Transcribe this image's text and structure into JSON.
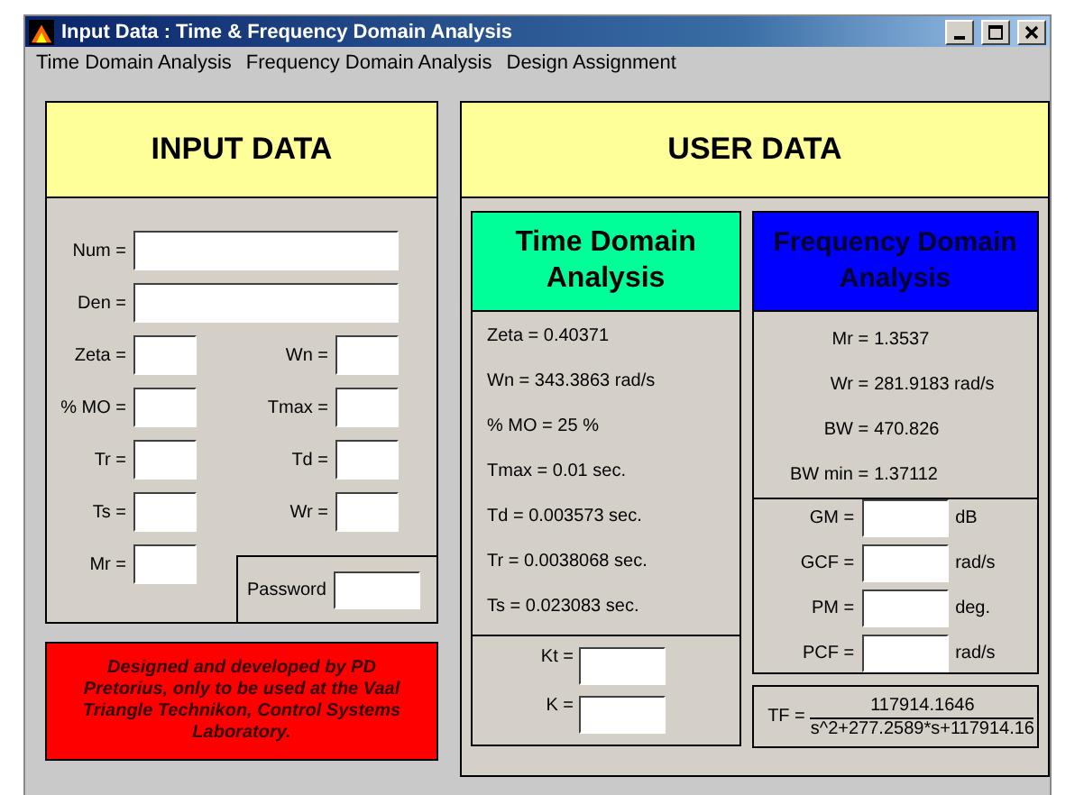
{
  "window": {
    "title": "Input Data : Time & Frequency Domain Analysis"
  },
  "menu": [
    {
      "label": "Time Domain Analysis"
    },
    {
      "label": "Frequency Domain Analysis"
    },
    {
      "label": "Design Assignment"
    }
  ],
  "input_panel": {
    "title": "INPUT DATA",
    "wide_fields": [
      {
        "label": "Num ="
      },
      {
        "label": "Den ="
      }
    ],
    "left_fields": [
      {
        "label": "Zeta ="
      },
      {
        "label": "% MO ="
      },
      {
        "label": "Tr ="
      },
      {
        "label": "Ts ="
      },
      {
        "label": "Mr ="
      }
    ],
    "right_fields": [
      {
        "label": "Wn ="
      },
      {
        "label": "Tmax ="
      },
      {
        "label": "Td ="
      },
      {
        "label": "Wr ="
      }
    ],
    "password": {
      "label": "Password"
    }
  },
  "notice": "Designed and developed by PD Pretorius, only to be used at the Vaal Triangle Technikon, Control Systems Laboratory.",
  "user_panel": {
    "title": "USER DATA",
    "time_domain": {
      "title": "Time Domain Analysis",
      "results": [
        "Zeta = 0.40371",
        "Wn = 343.3863 rad/s",
        "% MO = 25 %",
        "Tmax = 0.01 sec.",
        "Td = 0.003573 sec.",
        "Tr = 0.0038068 sec.",
        "Ts = 0.023083 sec."
      ],
      "gain_fields": [
        {
          "label": "Kt ="
        },
        {
          "label": "K ="
        }
      ]
    },
    "frequency_domain": {
      "title": "Frequency Domain Analysis",
      "results": [
        "Mr = 1.3537",
        "Wr = 281.9183 rad/s",
        "BW = 470.826",
        "BW min = 1.37112"
      ],
      "margin_fields": [
        {
          "label": "GM =",
          "unit": "dB"
        },
        {
          "label": "GCF =",
          "unit": "rad/s"
        },
        {
          "label": "PM =",
          "unit": "deg."
        },
        {
          "label": "PCF =",
          "unit": "rad/s"
        }
      ],
      "tf": {
        "label": "TF =",
        "numerator": "117914.1646",
        "denominator": "s^2+277.2589*s+117914.16"
      }
    }
  }
}
